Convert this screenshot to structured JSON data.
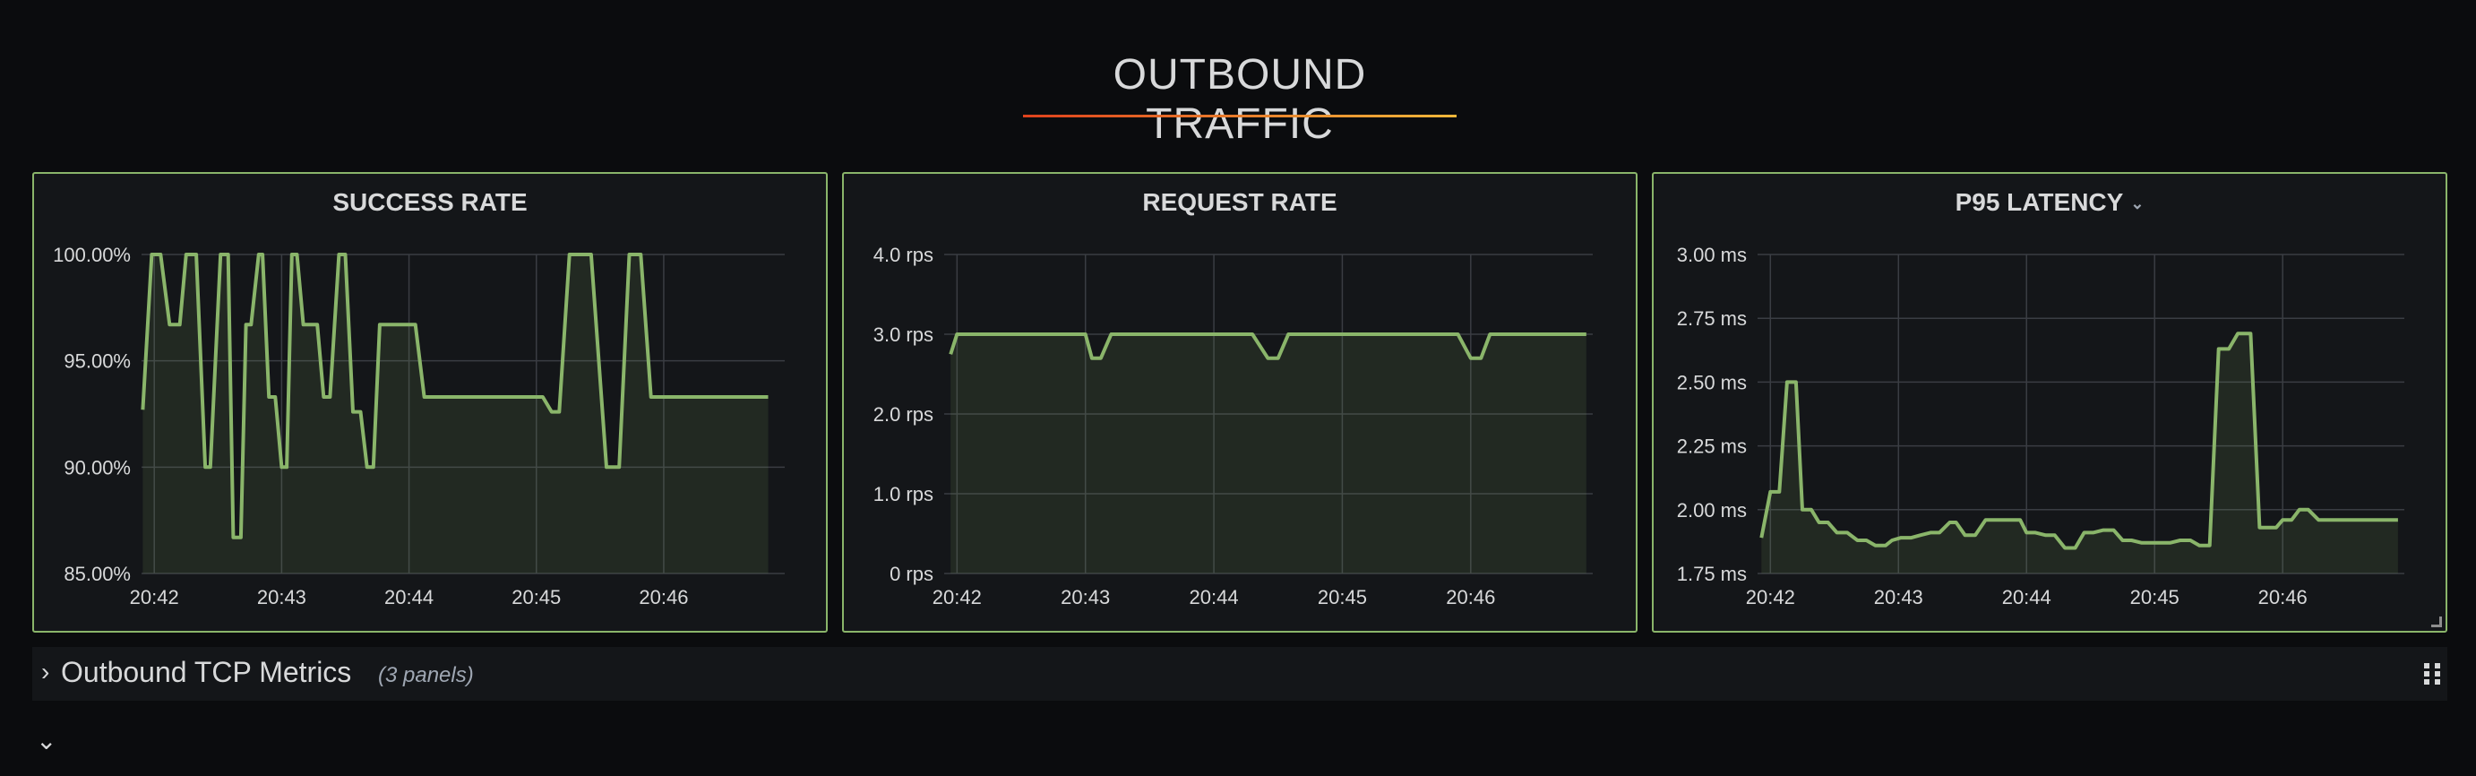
{
  "dashboard": {
    "section_title": "OUTBOUND TRAFFIC",
    "row": {
      "title": "Outbound TCP Metrics",
      "count": "(3 panels)"
    },
    "colors": {
      "series": "#8ab56a",
      "panel_border": "#8ab56a",
      "grid": "#3a3d43"
    }
  },
  "chart_data": [
    {
      "type": "area",
      "title": "SUCCESS RATE",
      "ylim": [
        85,
        100
      ],
      "y_ticks": [
        85,
        90,
        95,
        100
      ],
      "y_tick_labels": [
        "85.00%",
        "90.00%",
        "95.00%",
        "100.00%"
      ],
      "xlim": [
        0,
        5
      ],
      "x_ticks": [
        0,
        1,
        2,
        3,
        4
      ],
      "x_tick_labels": [
        "20:42",
        "20:43",
        "20:44",
        "20:45",
        "20:46"
      ],
      "grid": true,
      "series": [
        {
          "x": [
            -0.09,
            -0.02,
            0.05,
            0.12,
            0.2,
            0.25,
            0.33,
            0.4,
            0.44,
            0.52,
            0.58,
            0.62,
            0.68,
            0.72,
            0.76,
            0.82,
            0.85,
            0.9,
            0.95,
            1.0,
            1.04,
            1.08,
            1.12,
            1.17,
            1.22,
            1.28,
            1.33,
            1.38,
            1.45,
            1.5,
            1.56,
            1.62,
            1.67,
            1.72,
            1.77,
            1.85,
            1.92,
            1.97,
            2.05,
            2.12,
            2.18,
            2.27,
            2.33,
            2.38,
            2.43,
            2.48,
            2.52,
            2.57,
            2.6,
            2.65,
            2.7,
            2.76,
            2.82,
            2.87,
            2.92,
            2.96,
            3.05,
            3.12,
            3.18,
            3.26,
            3.33,
            3.38,
            3.43,
            3.55,
            3.65,
            3.73,
            3.82,
            3.9,
            3.95,
            4.0,
            4.05,
            4.1,
            4.15,
            4.2,
            4.3,
            4.4,
            4.45,
            4.5,
            4.55,
            4.6,
            4.65,
            4.7,
            4.75,
            4.8,
            4.82
          ],
          "y": [
            92.7,
            100,
            100,
            96.7,
            96.7,
            100,
            100,
            90,
            90,
            100,
            100,
            86.7,
            86.7,
            96.7,
            96.7,
            100,
            100,
            93.3,
            93.3,
            90,
            90,
            100,
            100,
            96.7,
            96.7,
            96.7,
            93.3,
            93.3,
            100,
            100,
            92.6,
            92.6,
            90,
            90,
            96.7,
            96.7,
            96.7,
            96.7,
            96.7,
            93.3,
            93.3,
            93.3,
            93.3,
            93.3,
            93.3,
            93.3,
            93.3,
            93.3,
            93.3,
            93.3,
            93.3,
            93.3,
            93.3,
            93.3,
            93.3,
            93.3,
            93.3,
            92.6,
            92.6,
            100,
            100,
            100,
            100,
            90,
            90,
            100,
            100,
            93.3,
            93.3,
            93.3,
            93.3,
            93.3,
            93.3,
            93.3,
            93.3,
            93.3,
            93.3,
            93.3,
            93.3,
            93.3,
            93.3,
            93.3,
            93.3,
            93.3,
            93.3
          ]
        }
      ]
    },
    {
      "type": "area",
      "title": "REQUEST RATE",
      "ylim": [
        0,
        4
      ],
      "y_ticks": [
        0,
        1,
        2,
        3,
        4
      ],
      "y_tick_labels": [
        "0 rps",
        "1.0 rps",
        "2.0 rps",
        "3.0 rps",
        "4.0 rps"
      ],
      "xlim": [
        0,
        5
      ],
      "x_ticks": [
        0,
        1,
        2,
        3,
        4
      ],
      "x_tick_labels": [
        "20:42",
        "20:43",
        "20:44",
        "20:45",
        "20:46"
      ],
      "grid": true,
      "series": [
        {
          "x": [
            -0.05,
            0.0,
            0.1,
            0.5,
            0.9,
            1.0,
            1.05,
            1.12,
            1.2,
            1.35,
            1.6,
            1.9,
            2.1,
            2.3,
            2.42,
            2.5,
            2.58,
            2.8,
            3.2,
            3.6,
            3.9,
            4.0,
            4.08,
            4.15,
            4.3,
            4.6,
            4.9
          ],
          "y": [
            2.75,
            3.0,
            3.0,
            3.0,
            3.0,
            3.0,
            2.7,
            2.7,
            3.0,
            3.0,
            3.0,
            3.0,
            3.0,
            3.0,
            2.7,
            2.7,
            3.0,
            3.0,
            3.0,
            3.0,
            3.0,
            2.7,
            2.7,
            3.0,
            3.0,
            3.0,
            3.0
          ]
        }
      ]
    },
    {
      "type": "area",
      "title": "P95 LATENCY",
      "ylim": [
        1.75,
        3.0
      ],
      "y_ticks": [
        1.75,
        2.0,
        2.25,
        2.5,
        2.75,
        3.0
      ],
      "y_tick_labels": [
        "1.75 ms",
        "2.00 ms",
        "2.25 ms",
        "2.50 ms",
        "2.75 ms",
        "3.00 ms"
      ],
      "xlim": [
        0,
        5
      ],
      "x_ticks": [
        0,
        1,
        2,
        3,
        4
      ],
      "x_tick_labels": [
        "20:42",
        "20:43",
        "20:44",
        "20:45",
        "20:46"
      ],
      "grid": true,
      "series": [
        {
          "x": [
            -0.07,
            0.0,
            0.07,
            0.13,
            0.2,
            0.25,
            0.32,
            0.38,
            0.45,
            0.52,
            0.6,
            0.68,
            0.75,
            0.82,
            0.9,
            0.95,
            1.02,
            1.1,
            1.17,
            1.25,
            1.32,
            1.4,
            1.45,
            1.52,
            1.6,
            1.68,
            1.75,
            1.85,
            1.95,
            2.0,
            2.07,
            2.15,
            2.22,
            2.3,
            2.38,
            2.45,
            2.52,
            2.6,
            2.68,
            2.75,
            2.82,
            2.9,
            2.98,
            3.05,
            3.12,
            3.2,
            3.28,
            3.35,
            3.43,
            3.5,
            3.58,
            3.65,
            3.75,
            3.82,
            3.9,
            3.95,
            4.0,
            4.07,
            4.13,
            4.2,
            4.28,
            4.35,
            4.43,
            4.5,
            4.58,
            4.65,
            4.72,
            4.8,
            4.9
          ],
          "y": [
            1.89,
            2.07,
            2.07,
            2.5,
            2.5,
            2.0,
            2.0,
            1.95,
            1.95,
            1.91,
            1.91,
            1.88,
            1.88,
            1.86,
            1.86,
            1.88,
            1.89,
            1.89,
            1.9,
            1.91,
            1.91,
            1.95,
            1.95,
            1.9,
            1.9,
            1.96,
            1.96,
            1.96,
            1.96,
            1.91,
            1.91,
            1.9,
            1.9,
            1.85,
            1.85,
            1.91,
            1.91,
            1.92,
            1.92,
            1.88,
            1.88,
            1.87,
            1.87,
            1.87,
            1.87,
            1.88,
            1.88,
            1.86,
            1.86,
            2.63,
            2.63,
            2.69,
            2.69,
            1.93,
            1.93,
            1.93,
            1.96,
            1.96,
            2.0,
            2.0,
            1.96,
            1.96,
            1.96,
            1.96,
            1.96,
            1.96,
            1.96,
            1.96,
            1.96
          ]
        }
      ]
    }
  ]
}
